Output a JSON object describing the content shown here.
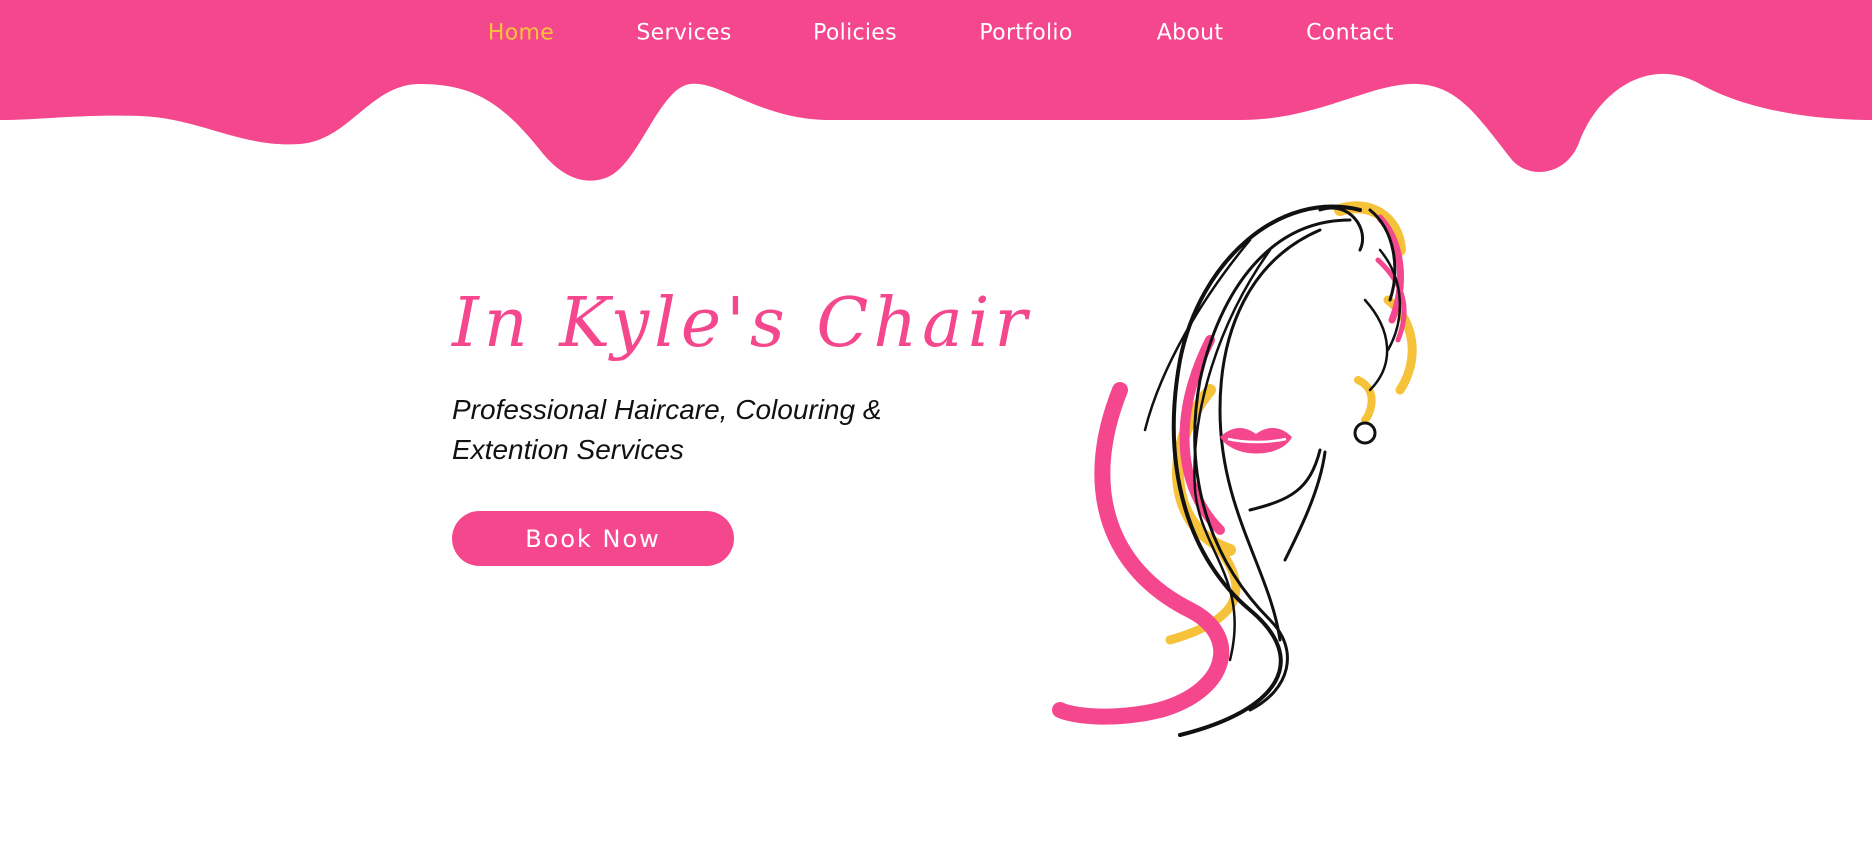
{
  "nav": {
    "items": [
      {
        "label": "Home",
        "active": true
      },
      {
        "label": "Services",
        "active": false
      },
      {
        "label": "Policies",
        "active": false
      },
      {
        "label": "Portfolio",
        "active": false
      },
      {
        "label": "About",
        "active": false
      },
      {
        "label": "Contact",
        "active": false
      }
    ]
  },
  "hero": {
    "title": "In Kyle's Chair",
    "tagline": "Professional Haircare, Colouring & Extention Services",
    "cta_label": "Book Now"
  },
  "colors": {
    "brand_pink": "#f5478d",
    "accent_yellow": "#f6c23a",
    "text_dark": "#111111",
    "background": "#ffffff"
  },
  "icons": {
    "hero_illustration": "woman-face-hair-illustration"
  }
}
